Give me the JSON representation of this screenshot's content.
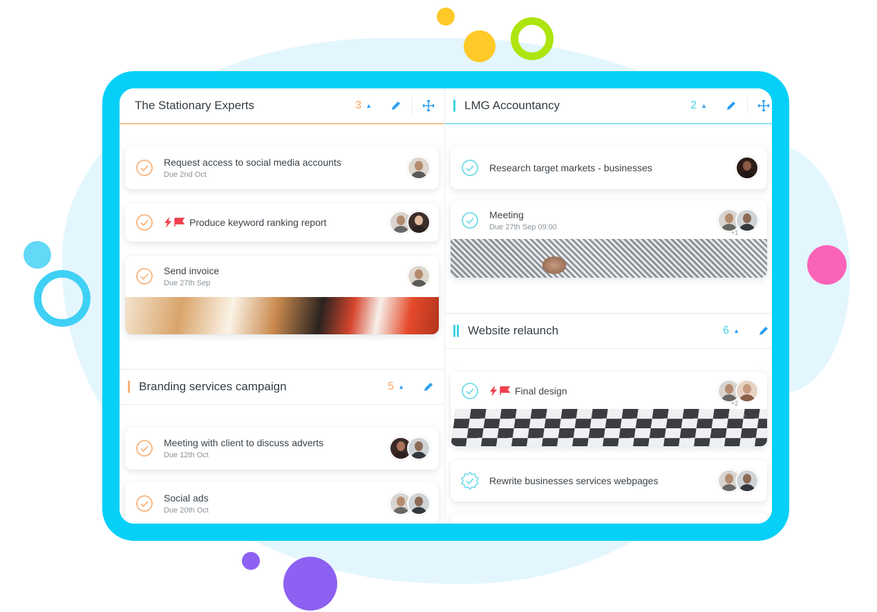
{
  "colors": {
    "frame": "#06d0f8",
    "orange": "#f7a25f",
    "teal": "#3ed3e6",
    "edit_blue": "#2f9ff0"
  },
  "board": {
    "left": {
      "groups": [
        {
          "title": "The Stationary Experts",
          "count": "3",
          "tasks": [
            {
              "title": "Request access to social media accounts",
              "due": "Due 2nd Oct"
            },
            {
              "title": "Produce keyword ranking report",
              "flags": [
                "lightning-icon",
                "flag-icon"
              ]
            },
            {
              "title": "Send invoice",
              "due": "Due 27th Sep",
              "image": "stationery-photo"
            }
          ]
        },
        {
          "title": "Branding services campaign",
          "count": "5",
          "tasks": [
            {
              "title": "Meeting with client to discuss adverts",
              "due": "Due 12th Oct"
            },
            {
              "title": "Social ads",
              "due": "Due 20th Oct"
            }
          ]
        }
      ]
    },
    "right": {
      "groups": [
        {
          "title": "LMG Accountancy",
          "count": "2",
          "tasks": [
            {
              "title": "Research target markets - businesses"
            },
            {
              "title": "Meeting",
              "due": "Due 27th Sep 09:00",
              "extra_assignees": "+1",
              "image": "meeting-photo"
            }
          ]
        },
        {
          "title": "Website relaunch",
          "count": "6",
          "tasks": [
            {
              "title": "Final design",
              "flags": [
                "lightning-icon",
                "flag-icon"
              ],
              "extra_assignees": "+2",
              "image": "checkered-photo"
            },
            {
              "title": "Rewrite businesses services webpages"
            }
          ]
        }
      ]
    }
  }
}
